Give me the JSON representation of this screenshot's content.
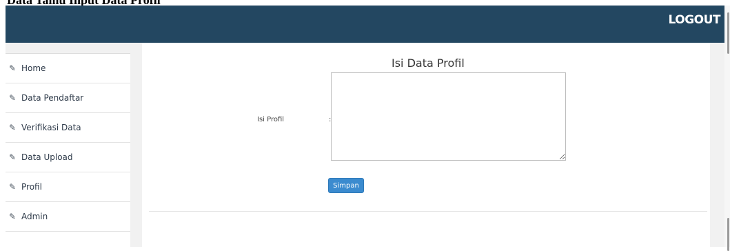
{
  "top_strip_text": "Data Tamu Input Data Profil",
  "header": {
    "logout_label": "LOGOUT"
  },
  "sidebar": {
    "items": [
      {
        "label": "Home",
        "icon": "edit-icon"
      },
      {
        "label": "Data Pendaftar",
        "icon": "edit-icon"
      },
      {
        "label": "Verifikasi Data",
        "icon": "edit-icon"
      },
      {
        "label": "Data Upload",
        "icon": "edit-icon"
      },
      {
        "label": "Profil",
        "icon": "edit-icon"
      },
      {
        "label": "Admin",
        "icon": "edit-icon"
      }
    ]
  },
  "form": {
    "title": "Isi Data Profil",
    "field_label": "Isi Profil",
    "colon": ":",
    "textarea_value": "",
    "save_label": "Simpan"
  },
  "colors": {
    "header_bg": "#234761",
    "button_bg": "#3b8bcf",
    "page_bg": "#f1f1f1"
  }
}
